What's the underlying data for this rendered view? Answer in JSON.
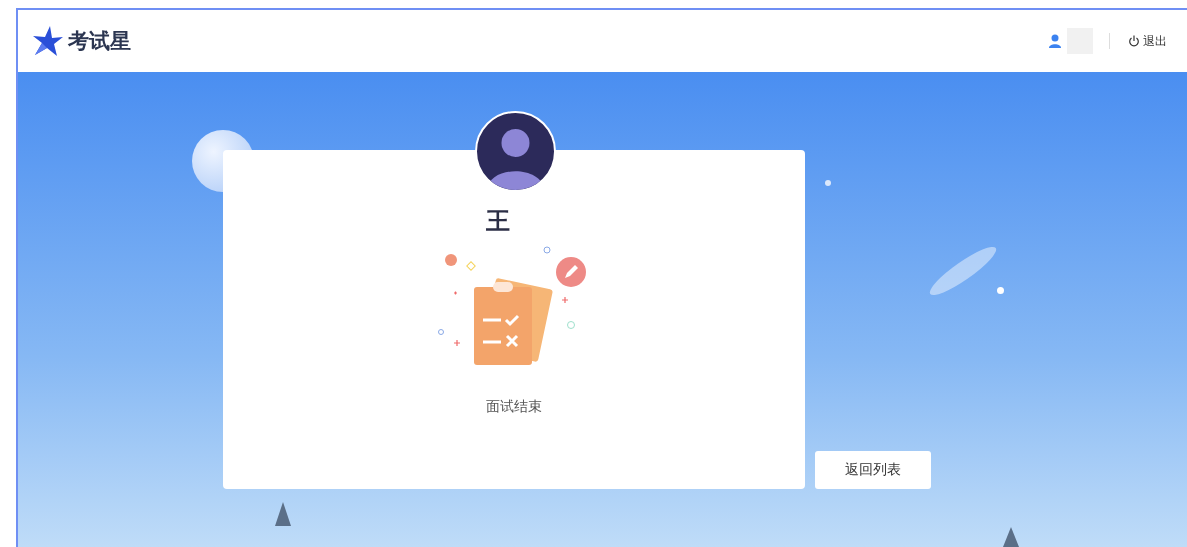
{
  "header": {
    "logo": "考试星",
    "logout": "退出"
  },
  "card": {
    "name": "王",
    "status": "面试结束"
  },
  "buttons": [
    "返回列表"
  ]
}
